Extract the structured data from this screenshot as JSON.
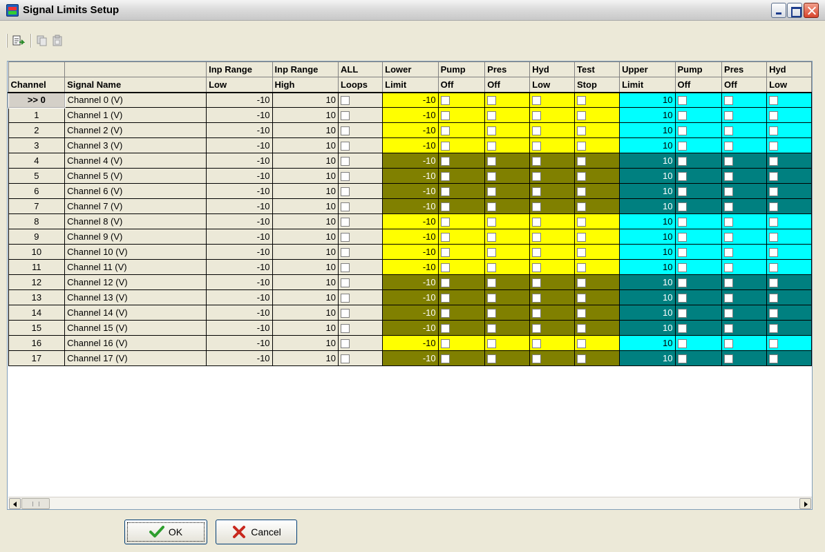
{
  "window": {
    "title": "Signal Limits Setup"
  },
  "toolbar": {
    "items": [
      "paste-icon",
      "copy-icon",
      "clipboard-icon"
    ]
  },
  "grid": {
    "header_row1": [
      "",
      "",
      "Inp Range",
      "Inp Range",
      "ALL",
      "Lower",
      "Pump",
      "Pres",
      "Hyd",
      "Test",
      "Upper",
      "Pump",
      "Pres",
      "Hyd"
    ],
    "header_row2": [
      "Channel",
      "Signal Name",
      "Low",
      "High",
      "Loops",
      "Limit",
      "Off",
      "Off",
      "Low",
      "Stop",
      "Limit",
      "Off",
      "Off",
      "Low"
    ],
    "rows": [
      {
        "channel": ">> 0",
        "name": "Channel 0 (V)",
        "low": "-10",
        "high": "10",
        "lower": "-10",
        "upper": "10",
        "shade": "light"
      },
      {
        "channel": "1",
        "name": "Channel 1 (V)",
        "low": "-10",
        "high": "10",
        "lower": "-10",
        "upper": "10",
        "shade": "light"
      },
      {
        "channel": "2",
        "name": "Channel 2 (V)",
        "low": "-10",
        "high": "10",
        "lower": "-10",
        "upper": "10",
        "shade": "light"
      },
      {
        "channel": "3",
        "name": "Channel 3 (V)",
        "low": "-10",
        "high": "10",
        "lower": "-10",
        "upper": "10",
        "shade": "light"
      },
      {
        "channel": "4",
        "name": "Channel 4 (V)",
        "low": "-10",
        "high": "10",
        "lower": "-10",
        "upper": "10",
        "shade": "dark"
      },
      {
        "channel": "5",
        "name": "Channel 5 (V)",
        "low": "-10",
        "high": "10",
        "lower": "-10",
        "upper": "10",
        "shade": "dark"
      },
      {
        "channel": "6",
        "name": "Channel 6 (V)",
        "low": "-10",
        "high": "10",
        "lower": "-10",
        "upper": "10",
        "shade": "dark"
      },
      {
        "channel": "7",
        "name": "Channel 7 (V)",
        "low": "-10",
        "high": "10",
        "lower": "-10",
        "upper": "10",
        "shade": "dark"
      },
      {
        "channel": "8",
        "name": "Channel 8 (V)",
        "low": "-10",
        "high": "10",
        "lower": "-10",
        "upper": "10",
        "shade": "light"
      },
      {
        "channel": "9",
        "name": "Channel 9 (V)",
        "low": "-10",
        "high": "10",
        "lower": "-10",
        "upper": "10",
        "shade": "light"
      },
      {
        "channel": "10",
        "name": "Channel 10 (V)",
        "low": "-10",
        "high": "10",
        "lower": "-10",
        "upper": "10",
        "shade": "light"
      },
      {
        "channel": "11",
        "name": "Channel 11 (V)",
        "low": "-10",
        "high": "10",
        "lower": "-10",
        "upper": "10",
        "shade": "light"
      },
      {
        "channel": "12",
        "name": "Channel 12 (V)",
        "low": "-10",
        "high": "10",
        "lower": "-10",
        "upper": "10",
        "shade": "dark"
      },
      {
        "channel": "13",
        "name": "Channel 13 (V)",
        "low": "-10",
        "high": "10",
        "lower": "-10",
        "upper": "10",
        "shade": "dark"
      },
      {
        "channel": "14",
        "name": "Channel 14 (V)",
        "low": "-10",
        "high": "10",
        "lower": "-10",
        "upper": "10",
        "shade": "dark"
      },
      {
        "channel": "15",
        "name": "Channel 15 (V)",
        "low": "-10",
        "high": "10",
        "lower": "-10",
        "upper": "10",
        "shade": "dark"
      },
      {
        "channel": "16",
        "name": "Channel 16 (V)",
        "low": "-10",
        "high": "10",
        "lower": "-10",
        "upper": "10",
        "shade": "light"
      },
      {
        "channel": "17",
        "name": "Channel 17 (V)",
        "low": "-10",
        "high": "10",
        "lower": "-10",
        "upper": "10",
        "shade": "dark"
      }
    ]
  },
  "buttons": {
    "ok": "OK",
    "cancel": "Cancel"
  },
  "colors": {
    "lower_light": "#ffff00",
    "lower_dark": "#808000",
    "upper_light": "#00ffff",
    "upper_dark": "#008080",
    "ok_icon": "#2e9e2e",
    "cancel_icon": "#c8281e"
  }
}
